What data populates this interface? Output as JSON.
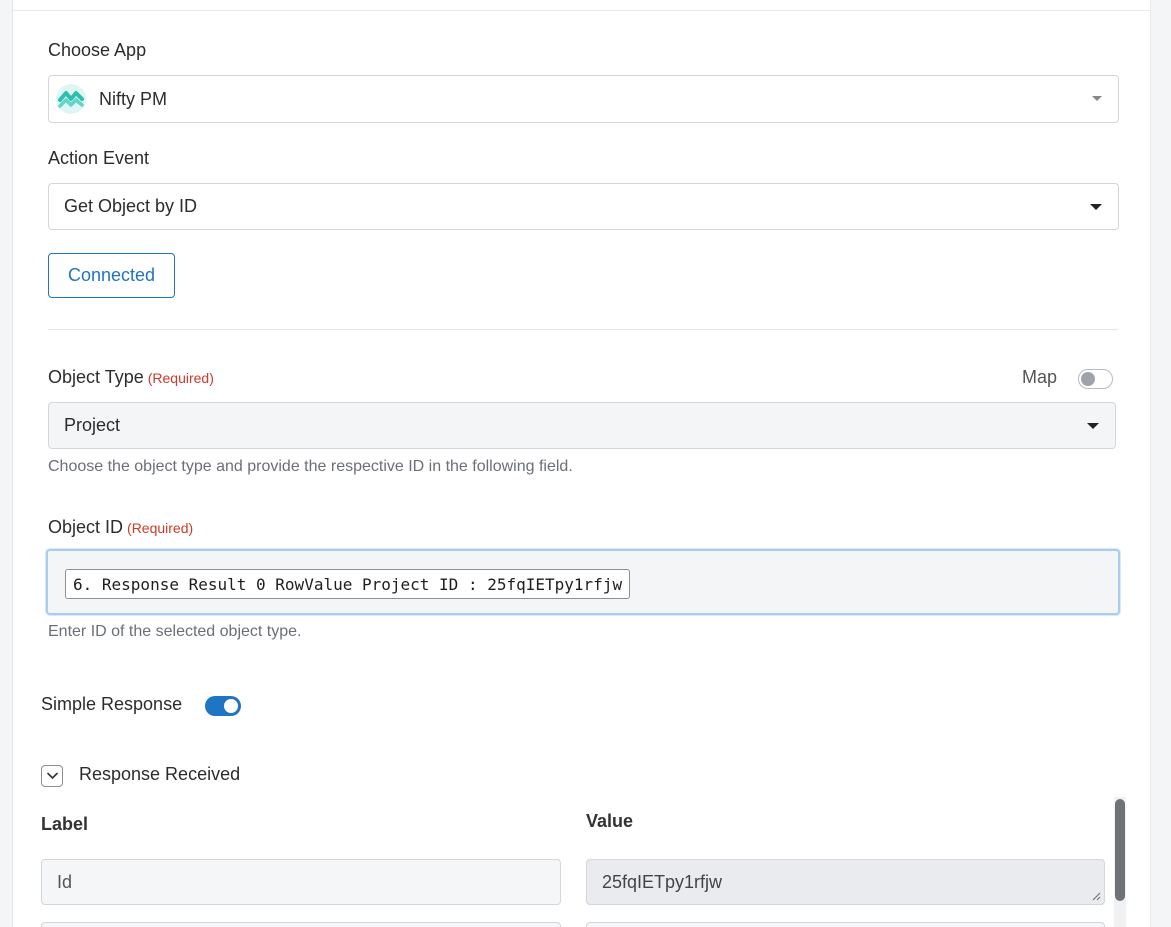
{
  "choose_app": {
    "label": "Choose App",
    "selected": "Nifty PM",
    "logo_icon": "nifty-pm-logo-icon"
  },
  "action_event": {
    "label": "Action Event",
    "selected": "Get Object by ID"
  },
  "connection": {
    "button_label": "Connected"
  },
  "object_type": {
    "label": "Object Type",
    "required": "(Required)",
    "map_label": "Map",
    "map_enabled": false,
    "selected": "Project",
    "help": "Choose the object type and provide the respective ID in the following field."
  },
  "object_id": {
    "label": "Object ID",
    "required": "(Required)",
    "token": "6. Response Result 0 RowValue Project ID : 25fqIETpy1rfjw",
    "help": "Enter ID of the selected object type."
  },
  "simple_response": {
    "label": "Simple Response",
    "enabled": true
  },
  "response_received": {
    "label": "Response Received",
    "col_label": "Label",
    "col_value": "Value",
    "rows": [
      {
        "label": "Id",
        "value": "25fqIETpy1rfjw"
      }
    ]
  },
  "colors": {
    "primary": "#1f74c4",
    "required": "#d0392b",
    "focus_border": "#a9cdf0"
  }
}
